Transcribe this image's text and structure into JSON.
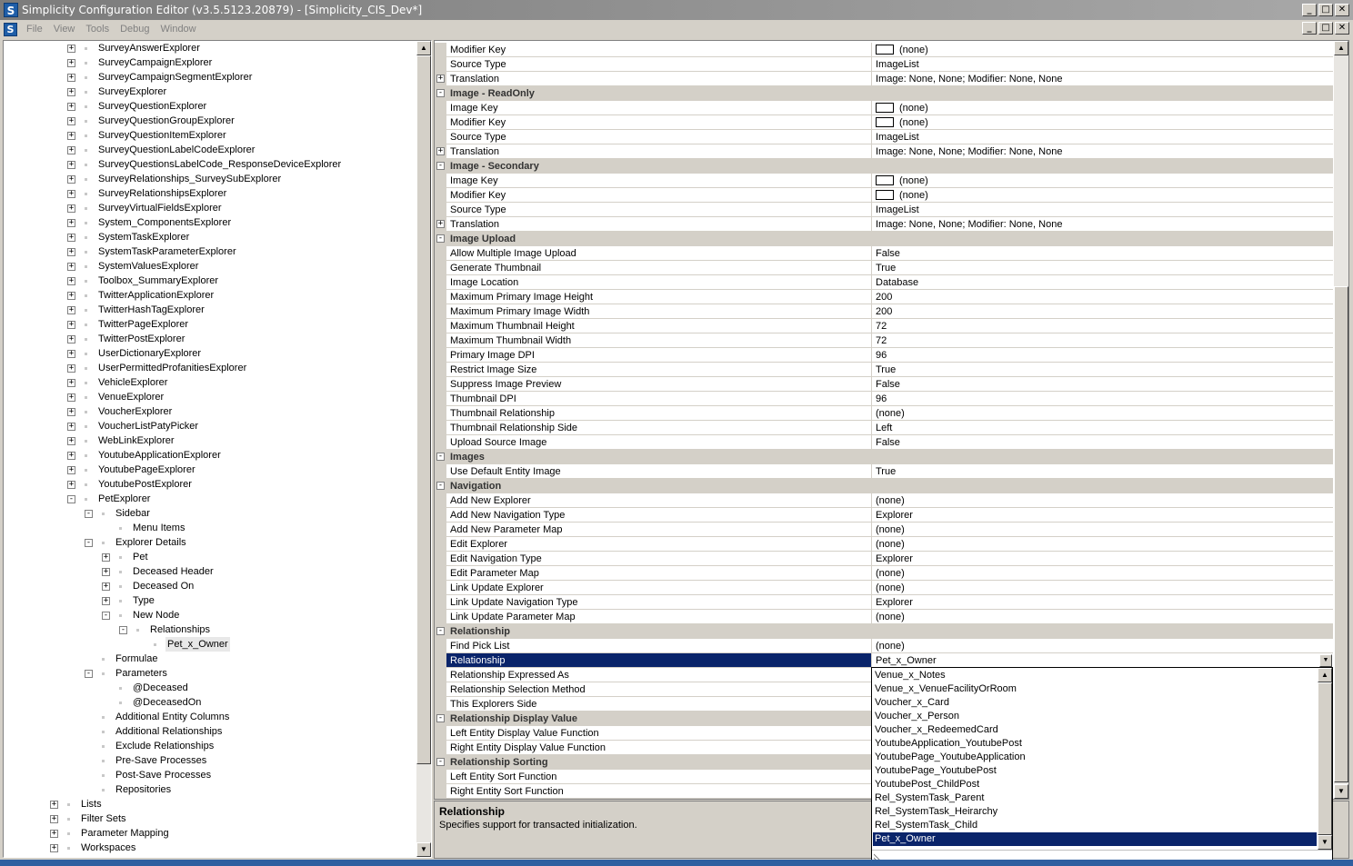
{
  "window": {
    "title": "Simplicity Configuration Editor (v3.5.5123.20879) - [Simplicity_CIS_Dev*]",
    "app_icon": "S"
  },
  "window_buttons": {
    "minimize": "_",
    "maximize": "□",
    "close": "✕"
  },
  "menu": [
    "File",
    "View",
    "Tools",
    "Debug",
    "Window"
  ],
  "tree": [
    {
      "label": "SurveyAnswerExplorer",
      "level": 2,
      "exp": "+"
    },
    {
      "label": "SurveyCampaignExplorer",
      "level": 2,
      "exp": "+"
    },
    {
      "label": "SurveyCampaignSegmentExplorer",
      "level": 2,
      "exp": "+"
    },
    {
      "label": "SurveyExplorer",
      "level": 2,
      "exp": "+"
    },
    {
      "label": "SurveyQuestionExplorer",
      "level": 2,
      "exp": "+"
    },
    {
      "label": "SurveyQuestionGroupExplorer",
      "level": 2,
      "exp": "+"
    },
    {
      "label": "SurveyQuestionItemExplorer",
      "level": 2,
      "exp": "+"
    },
    {
      "label": "SurveyQuestionLabelCodeExplorer",
      "level": 2,
      "exp": "+"
    },
    {
      "label": "SurveyQuestionsLabelCode_ResponseDeviceExplorer",
      "level": 2,
      "exp": "+"
    },
    {
      "label": "SurveyRelationships_SurveySubExplorer",
      "level": 2,
      "exp": "+"
    },
    {
      "label": "SurveyRelationshipsExplorer",
      "level": 2,
      "exp": "+"
    },
    {
      "label": "SurveyVirtualFieldsExplorer",
      "level": 2,
      "exp": "+"
    },
    {
      "label": "System_ComponentsExplorer",
      "level": 2,
      "exp": "+"
    },
    {
      "label": "SystemTaskExplorer",
      "level": 2,
      "exp": "+"
    },
    {
      "label": "SystemTaskParameterExplorer",
      "level": 2,
      "exp": "+"
    },
    {
      "label": "SystemValuesExplorer",
      "level": 2,
      "exp": "+"
    },
    {
      "label": "Toolbox_SummaryExplorer",
      "level": 2,
      "exp": "+"
    },
    {
      "label": "TwitterApplicationExplorer",
      "level": 2,
      "exp": "+"
    },
    {
      "label": "TwitterHashTagExplorer",
      "level": 2,
      "exp": "+"
    },
    {
      "label": "TwitterPageExplorer",
      "level": 2,
      "exp": "+"
    },
    {
      "label": "TwitterPostExplorer",
      "level": 2,
      "exp": "+"
    },
    {
      "label": "UserDictionaryExplorer",
      "level": 2,
      "exp": "+"
    },
    {
      "label": "UserPermittedProfanitiesExplorer",
      "level": 2,
      "exp": "+"
    },
    {
      "label": "VehicleExplorer",
      "level": 2,
      "exp": "+"
    },
    {
      "label": "VenueExplorer",
      "level": 2,
      "exp": "+"
    },
    {
      "label": "VoucherExplorer",
      "level": 2,
      "exp": "+"
    },
    {
      "label": "VoucherListPatyPicker",
      "level": 2,
      "exp": "+"
    },
    {
      "label": "WebLinkExplorer",
      "level": 2,
      "exp": "+"
    },
    {
      "label": "YoutubeApplicationExplorer",
      "level": 2,
      "exp": "+"
    },
    {
      "label": "YoutubePageExplorer",
      "level": 2,
      "exp": "+"
    },
    {
      "label": "YoutubePostExplorer",
      "level": 2,
      "exp": "+"
    },
    {
      "label": "PetExplorer",
      "level": 2,
      "exp": "-"
    },
    {
      "label": "Sidebar",
      "level": 3,
      "exp": "-"
    },
    {
      "label": "Menu Items",
      "level": 4,
      "exp": ""
    },
    {
      "label": "Explorer Details",
      "level": 3,
      "exp": "-"
    },
    {
      "label": "Pet",
      "level": 4,
      "exp": "+"
    },
    {
      "label": "Deceased Header",
      "level": 4,
      "exp": "+"
    },
    {
      "label": "Deceased On",
      "level": 4,
      "exp": "+"
    },
    {
      "label": "Type",
      "level": 4,
      "exp": "+"
    },
    {
      "label": "New Node",
      "level": 4,
      "exp": "-"
    },
    {
      "label": "Relationships",
      "level": 5,
      "exp": "-"
    },
    {
      "label": "Pet_x_Owner",
      "level": 6,
      "exp": "",
      "selected": true
    },
    {
      "label": "Formulae",
      "level": 3,
      "exp": ""
    },
    {
      "label": "Parameters",
      "level": 3,
      "exp": "-"
    },
    {
      "label": "@Deceased",
      "level": 4,
      "exp": ""
    },
    {
      "label": "@DeceasedOn",
      "level": 4,
      "exp": ""
    },
    {
      "label": "Additional Entity Columns",
      "level": 3,
      "exp": ""
    },
    {
      "label": "Additional Relationships",
      "level": 3,
      "exp": ""
    },
    {
      "label": "Exclude Relationships",
      "level": 3,
      "exp": ""
    },
    {
      "label": "Pre-Save Processes",
      "level": 3,
      "exp": ""
    },
    {
      "label": "Post-Save Processes",
      "level": 3,
      "exp": ""
    },
    {
      "label": "Repositories",
      "level": 3,
      "exp": ""
    },
    {
      "label": "Lists",
      "level": 1,
      "exp": "+"
    },
    {
      "label": "Filter Sets",
      "level": 1,
      "exp": "+"
    },
    {
      "label": "Parameter Mapping",
      "level": 1,
      "exp": "+"
    },
    {
      "label": "Workspaces",
      "level": 1,
      "exp": "+"
    }
  ],
  "props": [
    {
      "name": "Modifier Key",
      "value": "(none)",
      "swatch": true
    },
    {
      "name": "Source Type",
      "value": "ImageList"
    },
    {
      "name": "Translation",
      "value": "Image: None, None; Modifier: None, None",
      "exp": "+"
    },
    {
      "cat": "Image - ReadOnly"
    },
    {
      "name": "Image Key",
      "value": "(none)",
      "swatch": true
    },
    {
      "name": "Modifier Key",
      "value": "(none)",
      "swatch": true
    },
    {
      "name": "Source Type",
      "value": "ImageList"
    },
    {
      "name": "Translation",
      "value": "Image: None, None; Modifier: None, None",
      "exp": "+"
    },
    {
      "cat": "Image - Secondary"
    },
    {
      "name": "Image Key",
      "value": "(none)",
      "swatch": true
    },
    {
      "name": "Modifier Key",
      "value": "(none)",
      "swatch": true
    },
    {
      "name": "Source Type",
      "value": "ImageList"
    },
    {
      "name": "Translation",
      "value": "Image: None, None; Modifier: None, None",
      "exp": "+"
    },
    {
      "cat": "Image Upload"
    },
    {
      "name": "Allow Multiple Image Upload",
      "value": "False"
    },
    {
      "name": "Generate Thumbnail",
      "value": "True"
    },
    {
      "name": "Image Location",
      "value": "Database"
    },
    {
      "name": "Maximum Primary Image Height",
      "value": "200"
    },
    {
      "name": "Maximum Primary Image Width",
      "value": "200"
    },
    {
      "name": "Maximum Thumbnail Height",
      "value": "72"
    },
    {
      "name": "Maximum Thumbnail Width",
      "value": "72"
    },
    {
      "name": "Primary Image DPI",
      "value": "96"
    },
    {
      "name": "Restrict Image Size",
      "value": "True"
    },
    {
      "name": "Suppress Image Preview",
      "value": "False"
    },
    {
      "name": "Thumbnail DPI",
      "value": "96"
    },
    {
      "name": "Thumbnail Relationship",
      "value": "(none)"
    },
    {
      "name": "Thumbnail Relationship Side",
      "value": "Left"
    },
    {
      "name": "Upload Source Image",
      "value": "False"
    },
    {
      "cat": "Images"
    },
    {
      "name": "Use Default Entity Image",
      "value": "True"
    },
    {
      "cat": "Navigation"
    },
    {
      "name": "Add New Explorer",
      "value": "(none)"
    },
    {
      "name": "Add New Navigation Type",
      "value": "Explorer"
    },
    {
      "name": "Add New Parameter Map",
      "value": "(none)"
    },
    {
      "name": "Edit Explorer",
      "value": "(none)"
    },
    {
      "name": "Edit Navigation Type",
      "value": "Explorer"
    },
    {
      "name": "Edit Parameter Map",
      "value": "(none)"
    },
    {
      "name": "Link Update Explorer",
      "value": "(none)"
    },
    {
      "name": "Link Update Navigation Type",
      "value": "Explorer"
    },
    {
      "name": "Link Update Parameter Map",
      "value": "(none)"
    },
    {
      "cat": "Relationship"
    },
    {
      "name": "Find Pick List",
      "value": "(none)"
    },
    {
      "name": "Relationship",
      "value": "Pet_x_Owner",
      "selected": true,
      "dropdown": true
    },
    {
      "name": "Relationship Expressed As",
      "value": ""
    },
    {
      "name": "Relationship Selection Method",
      "value": ""
    },
    {
      "name": "This Explorers Side",
      "value": ""
    },
    {
      "cat": "Relationship Display Value"
    },
    {
      "name": "Left Entity Display Value Function",
      "value": ""
    },
    {
      "name": "Right Entity Display Value Function",
      "value": ""
    },
    {
      "cat": "Relationship Sorting"
    },
    {
      "name": "Left Entity Sort Function",
      "value": ""
    },
    {
      "name": "Right Entity Sort Function",
      "value": ""
    }
  ],
  "dropdown_items": [
    "Venue_x_Notes",
    "Venue_x_VenueFacilityOrRoom",
    "Voucher_x_Card",
    "Voucher_x_Person",
    "Voucher_x_RedeemedCard",
    "YoutubeApplication_YoutubePost",
    "YoutubePage_YoutubeApplication",
    "YoutubePage_YoutubePost",
    "YoutubePost_ChildPost",
    "Rel_SystemTask_Parent",
    "Rel_SystemTask_Heirarchy",
    "Rel_SystemTask_Child",
    "Pet_x_Owner"
  ],
  "dropdown_selected": "Pet_x_Owner",
  "help": {
    "title": "Relationship",
    "description": "Specifies support for transacted initialization."
  },
  "scroll_glyphs": {
    "up": "▲",
    "down": "▼"
  },
  "colors": {
    "selection": "#0a246a",
    "category_bg": "#d4d0c8",
    "title_bar": "#7b7b7b"
  },
  "icons": {
    "expand": "plus-icon",
    "collapse": "minus-icon",
    "node": "tree-node-icon"
  }
}
